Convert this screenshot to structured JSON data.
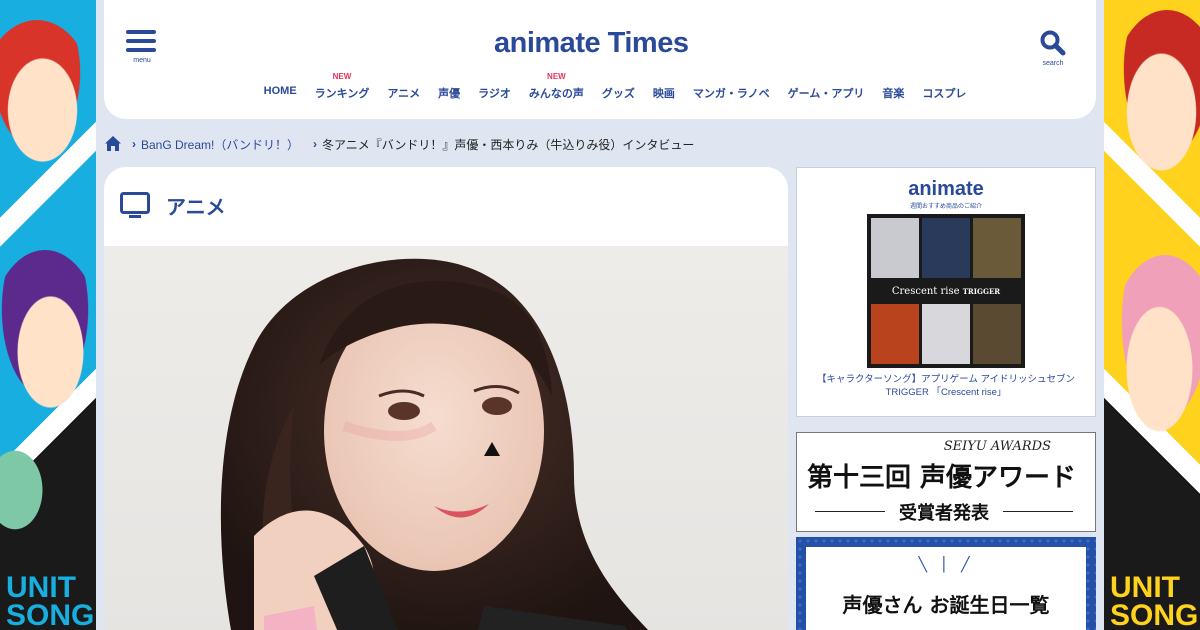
{
  "left_banner": {
    "text": "UNIT SONG"
  },
  "right_banner": {
    "text": "UNIT SONG"
  },
  "header": {
    "menu_label": "menu",
    "search_label": "search",
    "logo_text": "animate Times",
    "nav": [
      {
        "label": "HOME",
        "badge": ""
      },
      {
        "label": "ランキング",
        "badge": "NEW"
      },
      {
        "label": "アニメ",
        "badge": ""
      },
      {
        "label": "声優",
        "badge": ""
      },
      {
        "label": "ラジオ",
        "badge": ""
      },
      {
        "label": "みんなの声",
        "badge": "NEW"
      },
      {
        "label": "グッズ",
        "badge": ""
      },
      {
        "label": "映画",
        "badge": ""
      },
      {
        "label": "マンガ・ラノベ",
        "badge": ""
      },
      {
        "label": "ゲーム・アプリ",
        "badge": ""
      },
      {
        "label": "音楽",
        "badge": ""
      },
      {
        "label": "コスプレ",
        "badge": ""
      }
    ]
  },
  "breadcrumb": {
    "parent": "BanG Dream!（バンドリ！）",
    "current": "冬アニメ『バンドリ！』声優・西本りみ（牛込りみ役）インタビュー"
  },
  "main": {
    "category": "アニメ"
  },
  "sidebar": {
    "ad1": {
      "logo": "animate",
      "subtitle": "週間おすすめ商品のご紹介",
      "cover_title": "Crescent rise",
      "cover_brand": "TRIGGER",
      "caption": "【キャラクターソング】アプリゲーム アイドリッシュセブン TRIGGER 「Crescent rise」"
    },
    "ad2": {
      "en_title": "SEIYU AWARDS",
      "jp_title": "第十三回 声優アワード",
      "subtitle": "受賞者発表"
    },
    "ad3": {
      "text": "声優さん お誕生日一覧"
    }
  },
  "colors": {
    "brand": "#2a4a99",
    "badge": "#e0355b"
  }
}
